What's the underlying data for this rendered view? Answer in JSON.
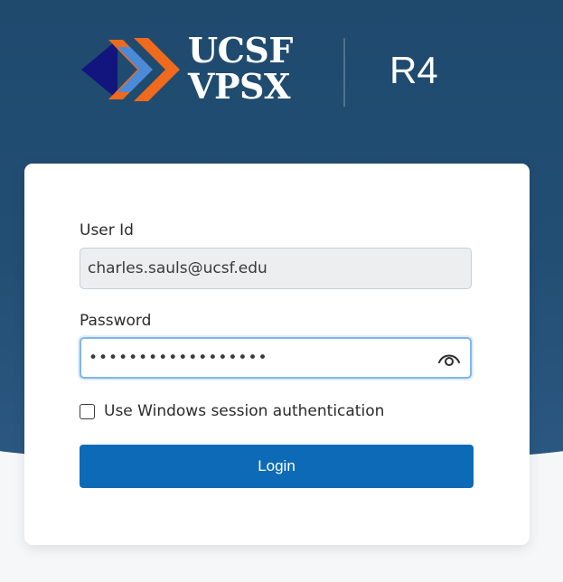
{
  "branding": {
    "logo_line1": "UCSF",
    "logo_line2": "VPSX",
    "product_name": "R4",
    "logo_icon": "chevron-arrows-logo"
  },
  "login_form": {
    "user_id_label": "User Id",
    "user_id_value": "charles.sauls@ucsf.edu",
    "password_label": "Password",
    "password_value": "••••••••••••••••••",
    "show_password_icon": "eye-icon",
    "windows_auth_label": "Use Windows session authentication",
    "windows_auth_checked": false,
    "login_button_label": "Login"
  },
  "colors": {
    "header_background": "#234e74",
    "login_button": "#0d6ab7",
    "focus_border": "#7fb5ea",
    "logo_navy": "#11157d",
    "logo_blue": "#4b8ad8",
    "logo_orange": "#ef6a1c"
  }
}
